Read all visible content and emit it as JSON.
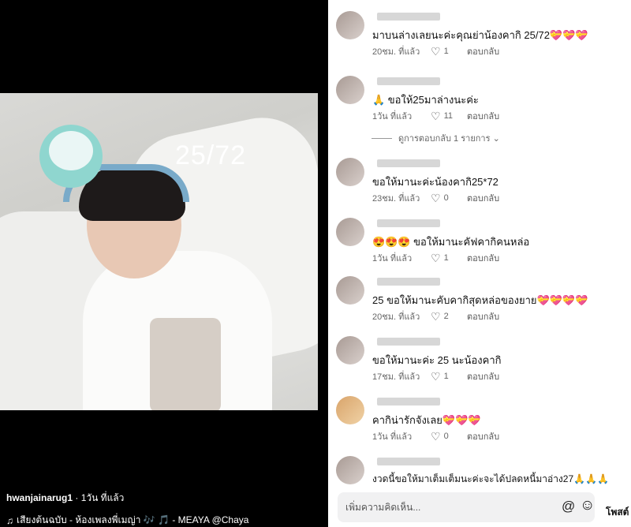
{
  "media": {
    "overlay_text": "25/72",
    "author": "hwanjainarug1",
    "separator": " · ",
    "posted": "1วัน ที่แล้ว",
    "music_icon": "♫",
    "sound_text": "เสียงต้นฉบับ - ห้องเพลงพี่เมญ่า 🎶 🎵 - MEAYA @Chaya"
  },
  "comments": [
    {
      "text": "มาบนล่างเลยนะค่ะคุณย่าน้องคากิ 25/72💝💝💝",
      "time": "20ชม. ที่แล้ว",
      "likes": "1",
      "reply": "ตอบกลับ"
    },
    {
      "text": "🙏 ขอให้25มาล่างนะค่ะ",
      "time": "1วัน ที่แล้ว",
      "likes": "11",
      "reply": "ตอบกลับ",
      "replies_label": "ดูการตอบกลับ 1 รายการ ⌄"
    },
    {
      "text": "ขอให้มานะค่ะน้องคากิ25*72",
      "time": "23ชม. ที่แล้ว",
      "likes": "0",
      "reply": "ตอบกลับ"
    },
    {
      "text": "😍😍😍 ขอให้มานะคัฟคากิคนหล่อ",
      "time": "1วัน ที่แล้ว",
      "likes": "1",
      "reply": "ตอบกลับ"
    },
    {
      "text": "25 ขอให้มานะคับคากิสุดหล่อของยาย💝💝💝💝",
      "time": "20ชม. ที่แล้ว",
      "likes": "2",
      "reply": "ตอบกลับ"
    },
    {
      "text": "ขอให้มานะค่ะ 25 นะน้องคากิ",
      "time": "17ชม. ที่แล้ว",
      "likes": "1",
      "reply": "ตอบกลับ"
    },
    {
      "text": "คากิน่ารักจังเลย💝💝💝",
      "time": "1วัน ที่แล้ว",
      "likes": "0",
      "reply": "ตอบกลับ"
    },
    {
      "text": "งวดนี้ขอให้มาเต็มเต็มนะค่ะจะได้ปลดหนี้มาอ่าง27🙏🙏🙏",
      "time": "",
      "likes": "",
      "reply": ""
    }
  ],
  "input": {
    "placeholder": "เพิ่มความคิดเห็น...",
    "at_symbol": "@",
    "emoji_symbol": "☺",
    "post_label": "โพสต์"
  },
  "icons": {
    "heart": "heart-outline-icon",
    "music": "music-note-icon",
    "at": "mention-icon",
    "emoji": "emoji-icon"
  }
}
